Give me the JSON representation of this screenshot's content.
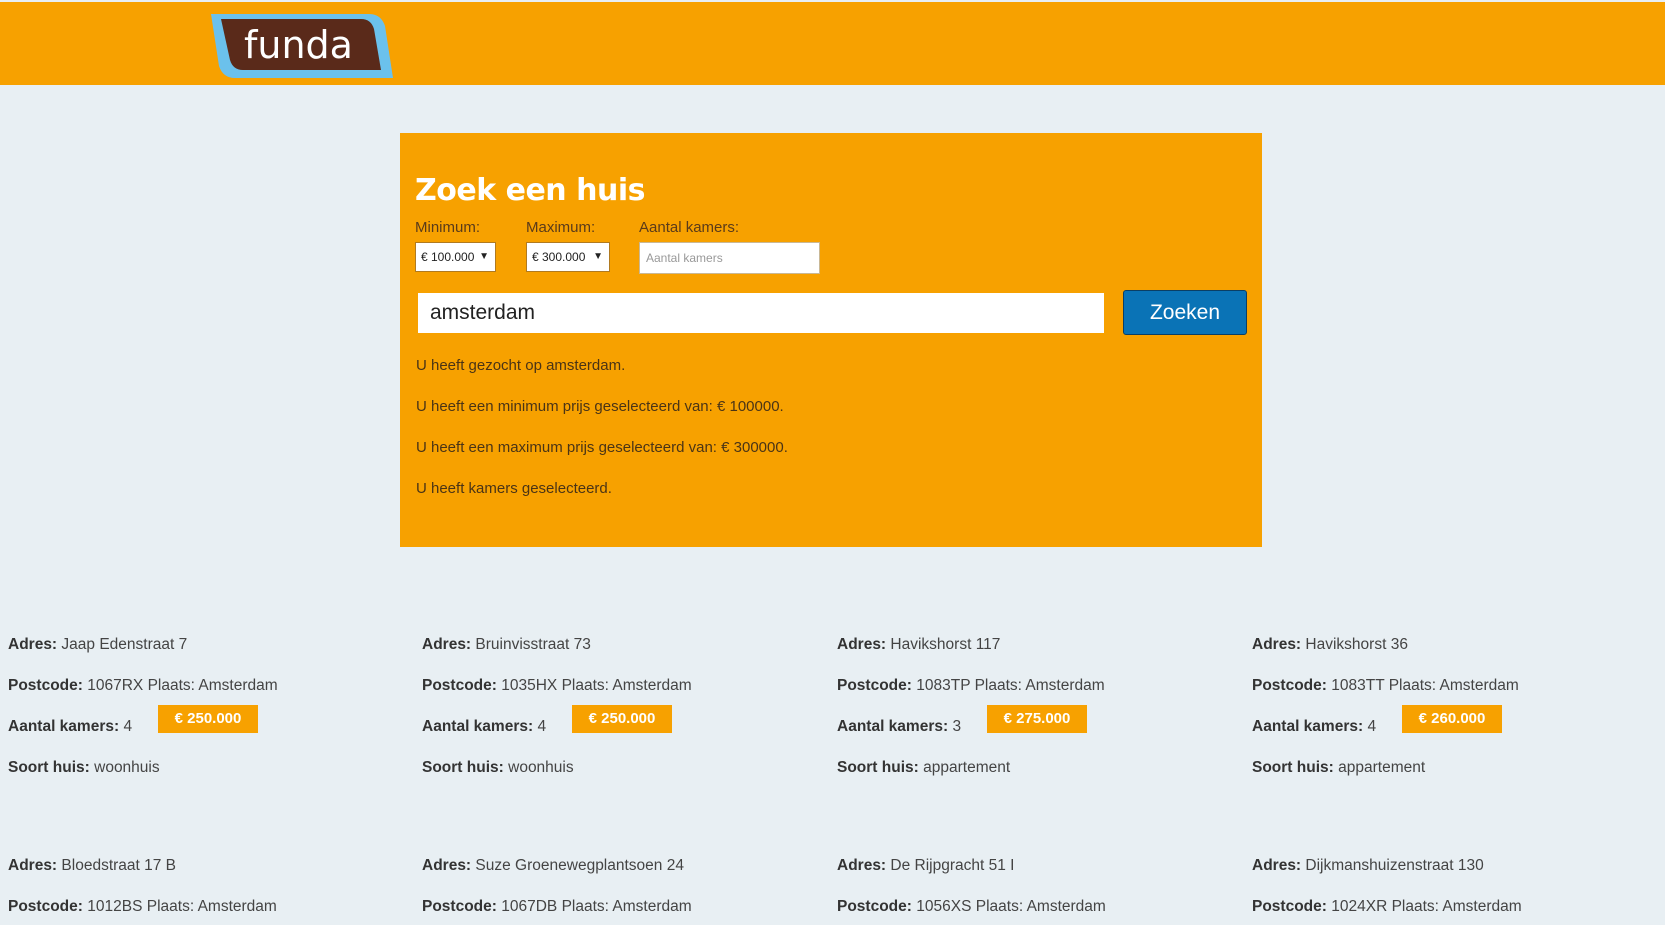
{
  "header": {
    "logo_text": "funda"
  },
  "search": {
    "title": "Zoek een huis",
    "min_label": "Minimum:",
    "min_value": "€ 100.000",
    "max_label": "Maximum:",
    "max_value": "€ 300.000",
    "rooms_label": "Aantal kamers:",
    "rooms_placeholder": "Aantal kamers",
    "query_value": "amsterdam",
    "button_label": "Zoeken",
    "info": [
      "U heeft gezocht op amsterdam.",
      "U heeft een minimum prijs geselecteerd van: € 100000.",
      "U heeft een maximum prijs geselecteerd van: € 300000.",
      "U heeft kamers geselecteerd."
    ]
  },
  "labels": {
    "address": "Adres:",
    "postcode": "Postcode:",
    "city": "Plaats:",
    "rooms": "Aantal kamers:",
    "type": "Soort huis:"
  },
  "listings": [
    {
      "address": "Jaap Edenstraat 7",
      "postcode": "1067RX",
      "city": "Amsterdam",
      "rooms": "4",
      "type": "woonhuis",
      "price": "€ 250.000"
    },
    {
      "address": "Bruinvisstraat 73",
      "postcode": "1035HX",
      "city": "Amsterdam",
      "rooms": "4",
      "type": "woonhuis",
      "price": "€ 250.000"
    },
    {
      "address": "Havikshorst 117",
      "postcode": "1083TP",
      "city": "Amsterdam",
      "rooms": "3",
      "type": "appartement",
      "price": "€ 275.000"
    },
    {
      "address": "Havikshorst 36",
      "postcode": "1083TT",
      "city": "Amsterdam",
      "rooms": "4",
      "type": "appartement",
      "price": "€ 260.000"
    },
    {
      "address": "Bloedstraat 17 B",
      "postcode": "1012BS",
      "city": "Amsterdam"
    },
    {
      "address": "Suze Groenewegplantsoen 24",
      "postcode": "1067DB",
      "city": "Amsterdam"
    },
    {
      "address": "De Rijpgracht 51 I",
      "postcode": "1056XS",
      "city": "Amsterdam"
    },
    {
      "address": "Dijkmanshuizenstraat 130",
      "postcode": "1024XR",
      "city": "Amsterdam"
    }
  ]
}
